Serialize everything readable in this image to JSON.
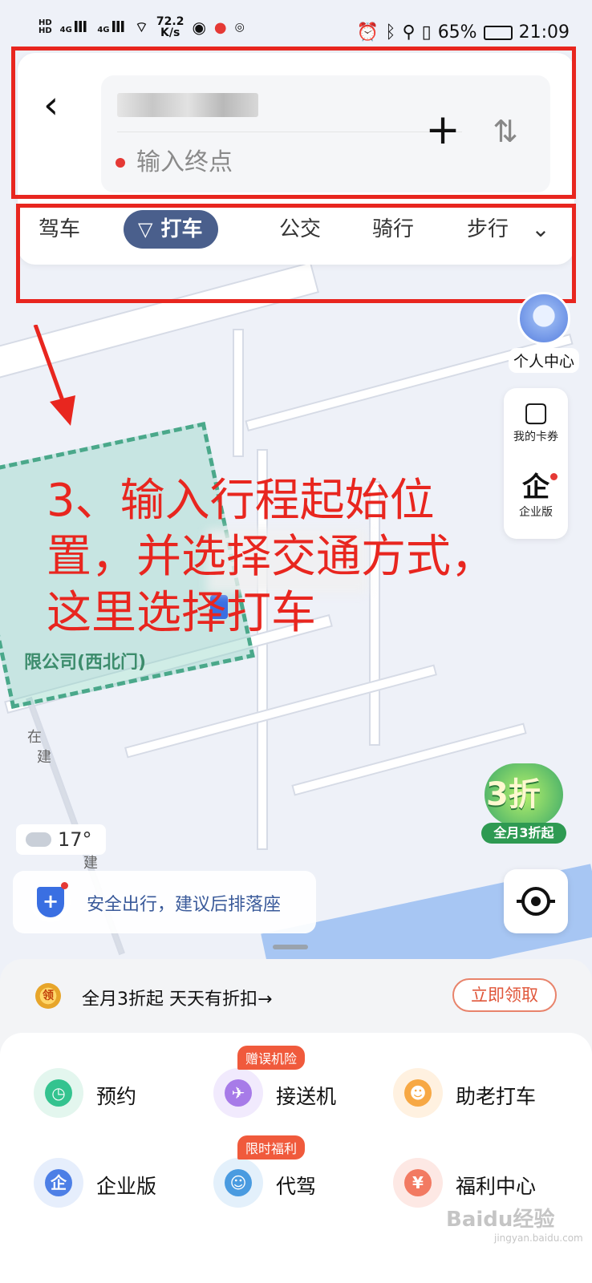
{
  "status_bar": {
    "net_speed": "72.2",
    "net_unit": "K/s",
    "battery": "65%",
    "time": "21:09"
  },
  "route": {
    "end_placeholder": "输入终点"
  },
  "modes": [
    "驾车",
    "打车",
    "公交",
    "骑行",
    "步行"
  ],
  "annotation": {
    "line1": "3、输入行程起始位",
    "line2": "置，并选择交通方式，",
    "line3": "这里选择打车"
  },
  "map_labels": {
    "company": "限公司(西北门)",
    "construction_1": "在",
    "construction_2": "建",
    "construction_3": "建"
  },
  "side": {
    "profile": "个人中心",
    "coupons": "我的卡券",
    "enterprise": "企业版"
  },
  "promo_badge": {
    "big": "3折",
    "sub": "全月3折起"
  },
  "weather": {
    "temp": "17°"
  },
  "safety": {
    "text": "安全出行，建议后排落座"
  },
  "promo_row": {
    "coin": "领",
    "text": "全月3折起  天天有折扣→",
    "button": "立即领取"
  },
  "services": [
    {
      "label": "预约",
      "tag": ""
    },
    {
      "label": "接送机",
      "tag": "赠误机险"
    },
    {
      "label": "助老打车",
      "tag": ""
    },
    {
      "label": "企业版",
      "tag": ""
    },
    {
      "label": "代驾",
      "tag": "限时福利"
    },
    {
      "label": "福利中心",
      "tag": ""
    }
  ],
  "watermark": {
    "main": "Baidu经验",
    "sub": "jingyan.baidu.com"
  },
  "colors": {
    "accent_blue": "#4a5f8c",
    "annotation_red": "#e8261f",
    "destination_dot": "#e53935"
  }
}
